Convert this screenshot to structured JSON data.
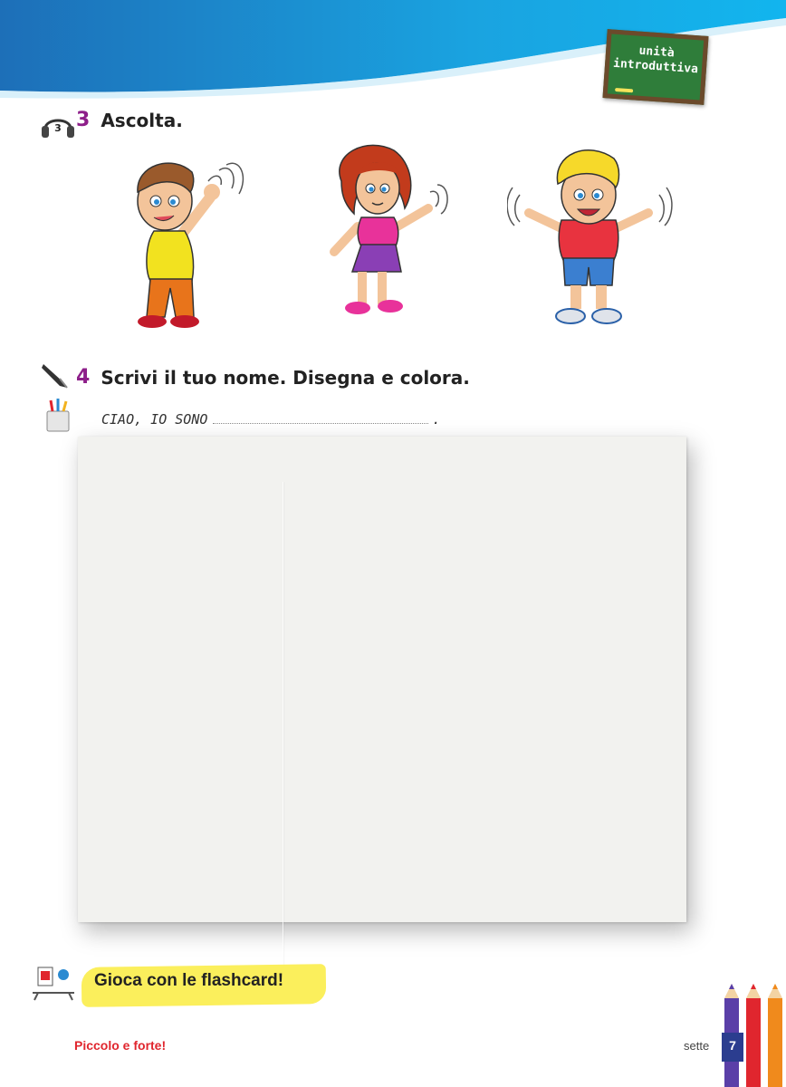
{
  "header": {
    "badge_line1": "unità",
    "badge_line2": "introduttiva"
  },
  "exercise3": {
    "track_number": "3",
    "number": "3",
    "title": "Ascolta."
  },
  "exercise4": {
    "number": "4",
    "title": "Scrivi il tuo nome. Disegna e colora.",
    "prompt": "CIAO, IO SONO",
    "end_punct": "."
  },
  "flashcard": {
    "label": "Gioca con le flashcard!"
  },
  "footer": {
    "book_title": "Piccolo e forte!",
    "page_word": "sette",
    "page_number": "7"
  },
  "colors": {
    "header_blue": "#1aa3e0",
    "exercise_number": "#8e1f8a",
    "banner_yellow": "#fbef5c",
    "footer_red": "#e0262e",
    "page_box": "#2b3d8f"
  }
}
